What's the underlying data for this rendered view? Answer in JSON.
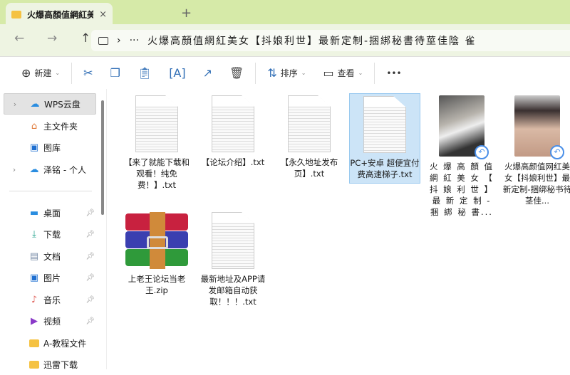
{
  "tab": {
    "title": "火爆高顏值網紅美女【抖",
    "close": "×",
    "new_tab": "+"
  },
  "nav": {
    "back": "←",
    "forward": "→",
    "up": "↑",
    "refresh": "↻",
    "more": "···",
    "sep": "›",
    "path": "火爆高顏值網紅美女【抖娘利世】最新定制-捆綁秘書待莖佳陰 雀"
  },
  "toolbar": {
    "new": "新建",
    "sort": "排序",
    "view": "查看",
    "more": "•••"
  },
  "sidebar": {
    "items": [
      {
        "label": "WPS云盘"
      },
      {
        "label": "主文件夹"
      },
      {
        "label": "图库"
      },
      {
        "label": "泽铭 - 个人"
      },
      {
        "label": "桌面"
      },
      {
        "label": "下载"
      },
      {
        "label": "文档"
      },
      {
        "label": "图片"
      },
      {
        "label": "音乐"
      },
      {
        "label": "视频"
      },
      {
        "label": "A-教程文件"
      },
      {
        "label": "迅雷下载"
      }
    ]
  },
  "files": [
    {
      "name": "【来了就能下载和观看！纯免费！】.txt",
      "type": "txt"
    },
    {
      "name": "【论坛介绍】.txt",
      "type": "txt"
    },
    {
      "name": "【永久地址发布页】.txt",
      "type": "txt"
    },
    {
      "name": "PC+安卓 超便宜付费高速梯子.txt",
      "type": "txt",
      "selected": true
    },
    {
      "name": "火 爆 高 顏 值 網 紅 美 女 【 抖 娘 利 世 】 最 新 定 制 - 捆 綁 秘 書...",
      "type": "video"
    },
    {
      "name": "火爆高颜值网红美女【抖娘利世】最新定制-捆绑秘书待茎佳...",
      "type": "video"
    },
    {
      "name": "上老王论坛当老王.zip",
      "type": "zip"
    },
    {
      "name": "最新地址及APP请发邮箱自动获取！！！.txt",
      "type": "txt"
    }
  ],
  "colors": {
    "tabbar": "#d6eaa8",
    "accent": "#2f6db5",
    "selection": "#cce4f7"
  }
}
